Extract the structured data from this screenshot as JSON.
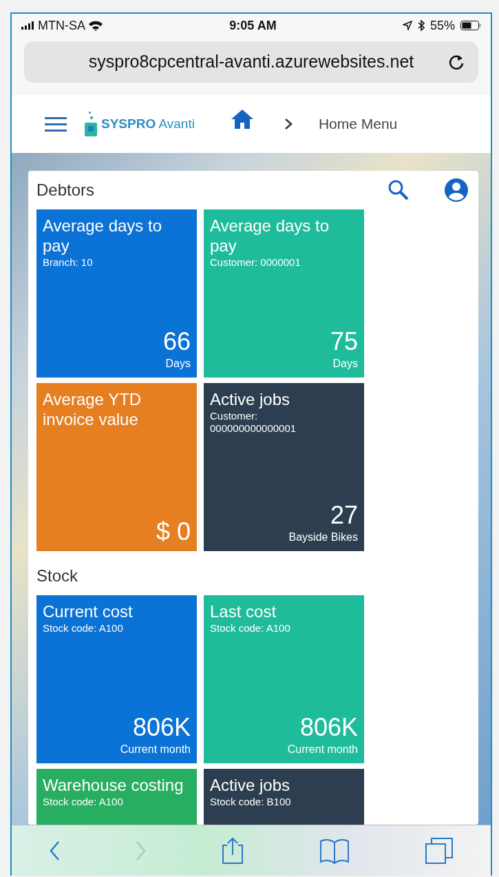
{
  "status_bar": {
    "carrier": "MTN-SA",
    "time": "9:05 AM",
    "battery": "55%"
  },
  "address_bar": {
    "url": "syspro8cpcentral-avanti.azurewebsites.net"
  },
  "header": {
    "logo_name": "SYSPRO",
    "logo_product": "Avanti",
    "breadcrumb": "Home Menu"
  },
  "sections": [
    {
      "title": "Debtors",
      "tiles": [
        {
          "title": "Average days to pay",
          "subtitle": "Branch: 10",
          "value": "66",
          "unit": "Days",
          "color": "#0b72d6"
        },
        {
          "title": "Average days to pay",
          "subtitle": "Customer: 0000001",
          "value": "75",
          "unit": "Days",
          "color": "#1fbc9b"
        },
        {
          "title": "Average YTD invoice value",
          "value": "$ 0",
          "color": "#e67e22"
        },
        {
          "title": "Active jobs",
          "subtitle": "Customer: 000000000000001",
          "value": "27",
          "unit": "Bayside Bikes",
          "color": "#2c3e50"
        }
      ]
    },
    {
      "title": "Stock",
      "tiles": [
        {
          "title": "Current cost",
          "subtitle": "Stock code: A100",
          "value": "806K",
          "unit": "Current month",
          "color": "#0b72d6"
        },
        {
          "title": "Last cost",
          "subtitle": "Stock code: A100",
          "value": "806K",
          "unit": "Current month",
          "color": "#1fbc9b"
        },
        {
          "title": "Warehouse costing",
          "subtitle": "Stock code: A100",
          "color": "#27ae60"
        },
        {
          "title": "Active jobs",
          "subtitle": "Stock code: B100",
          "color": "#2c3e50"
        }
      ]
    }
  ],
  "toolbar": [
    {
      "kind": "back",
      "disabled": false
    },
    {
      "kind": "forward",
      "disabled": true
    },
    {
      "kind": "share",
      "disabled": false
    },
    {
      "kind": "bookmarks",
      "disabled": false
    },
    {
      "kind": "tabs",
      "disabled": false
    }
  ]
}
